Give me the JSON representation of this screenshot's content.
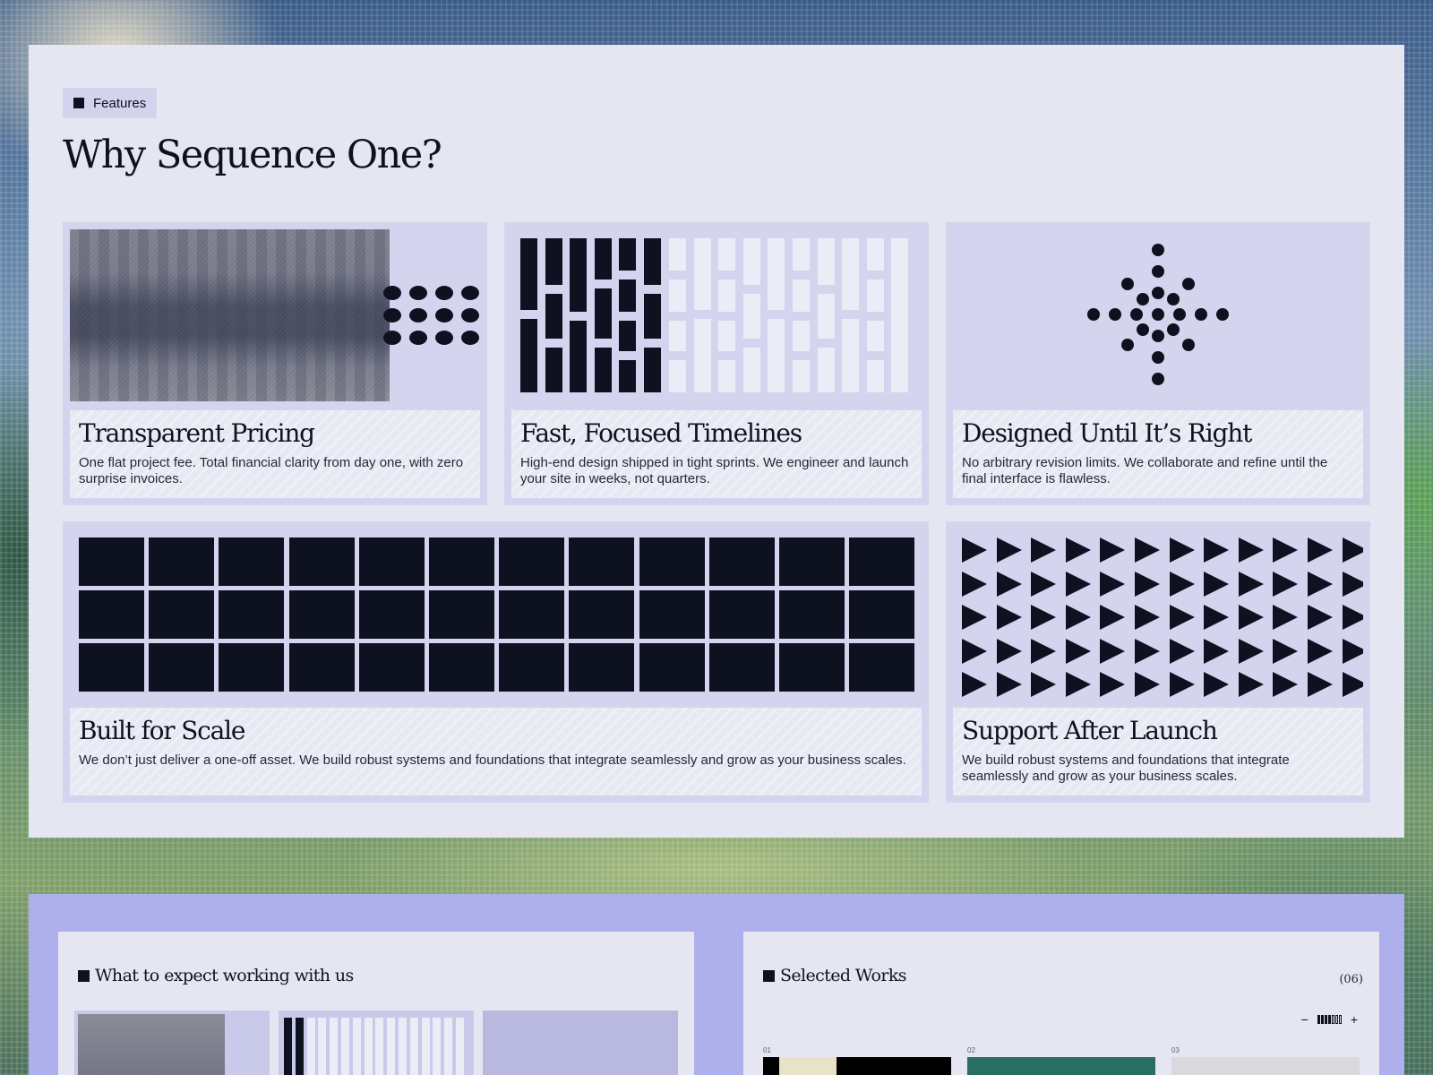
{
  "features": {
    "pill_label": "Features",
    "title": "Why Sequence One?",
    "cards": [
      {
        "title": "Transparent Pricing",
        "description": "One flat project fee. Total financial clarity from day one, with zero surprise invoices."
      },
      {
        "title": "Fast, Focused Timelines",
        "description": "High-end design shipped in tight sprints. We engineer and launch your site in weeks, not quarters."
      },
      {
        "title": "Designed Until It’s Right",
        "description": "No arbitrary revision limits. We collaborate and refine until the final interface is flawless."
      },
      {
        "title": "Built for Scale",
        "description": "We don’t just deliver a one-off asset. We build robust systems and foundations that integrate seamlessly and grow as your business scales."
      },
      {
        "title": "Support After Launch",
        "description": "We build robust systems and foundations that integrate seamlessly and grow as your business scales."
      }
    ]
  },
  "expect": {
    "title": "What to expect working with us"
  },
  "works": {
    "title": "Selected Works",
    "count": "(06)",
    "zoom_minus": "−",
    "zoom_plus": "+",
    "items": [
      {
        "number": "01"
      },
      {
        "number": "02"
      },
      {
        "number": "03"
      }
    ]
  },
  "colors": {
    "ink": "#0e1220",
    "card_bg": "#d4d4ef",
    "panel_bg": "#e6e6f2",
    "lower_panel_bg": "#adb0ea"
  }
}
